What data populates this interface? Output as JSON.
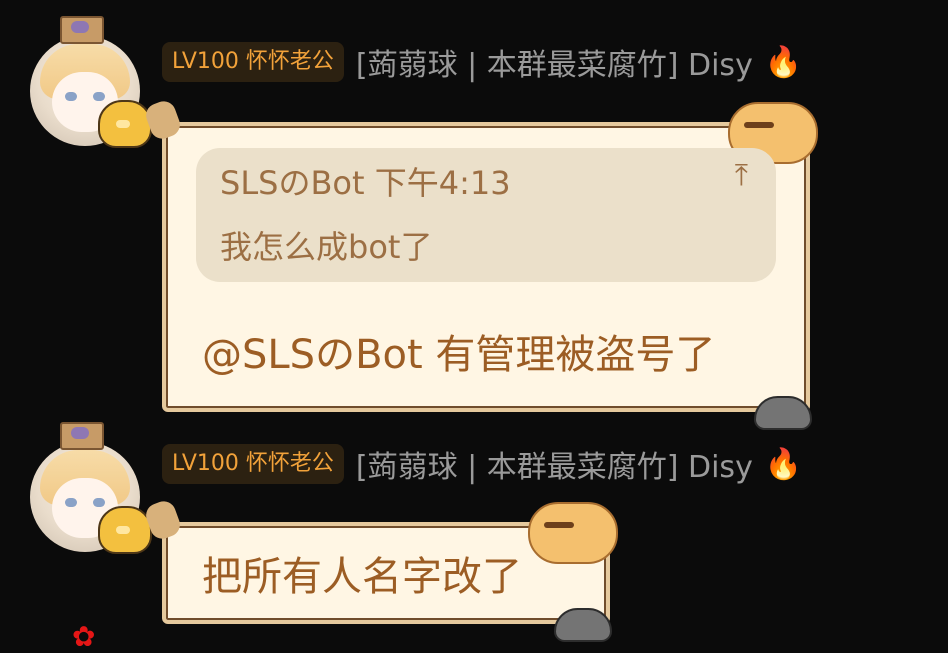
{
  "messages": [
    {
      "badge": "LV100 怀怀老公",
      "nickname": "[蒟蒻球 | 本群最菜腐竹] Disy",
      "icon": "fire-icon",
      "quote": {
        "sender": "SLSのBot",
        "time": "下午4:13",
        "jump_icon": "jump-to-original-icon",
        "text": "我怎么成bot了"
      },
      "text": "@SLSのBot 有管理被盗号了"
    },
    {
      "badge": "LV100 怀怀老公",
      "nickname": "[蒟蒻球 | 本群最菜腐竹] Disy",
      "icon": "fire-icon",
      "text": "把所有人名字改了"
    }
  ]
}
